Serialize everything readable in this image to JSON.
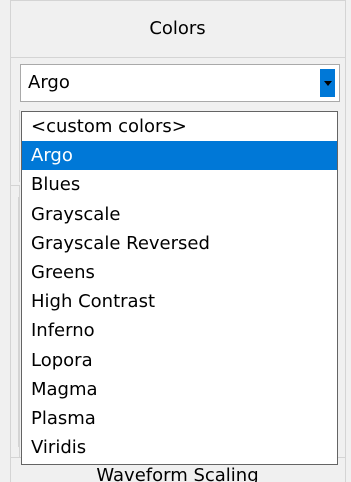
{
  "colors_panel": {
    "title": "Colors",
    "combobox": {
      "value": "Argo",
      "expanded": true
    },
    "options": [
      "<custom colors>",
      "Argo",
      "Blues",
      "Grayscale",
      "Grayscale Reversed",
      "Greens",
      "High Contrast",
      "Inferno",
      "Lopora",
      "Magma",
      "Plasma",
      "Viridis"
    ],
    "selected_option": "Argo"
  },
  "next_panel": {
    "title": "Waveform Scaling"
  },
  "colors": {
    "selection": "#0078d7",
    "background": "#f0f0f0",
    "border": "#d4d4d4"
  },
  "icons": {
    "dropdown": "chevron-down-icon"
  }
}
